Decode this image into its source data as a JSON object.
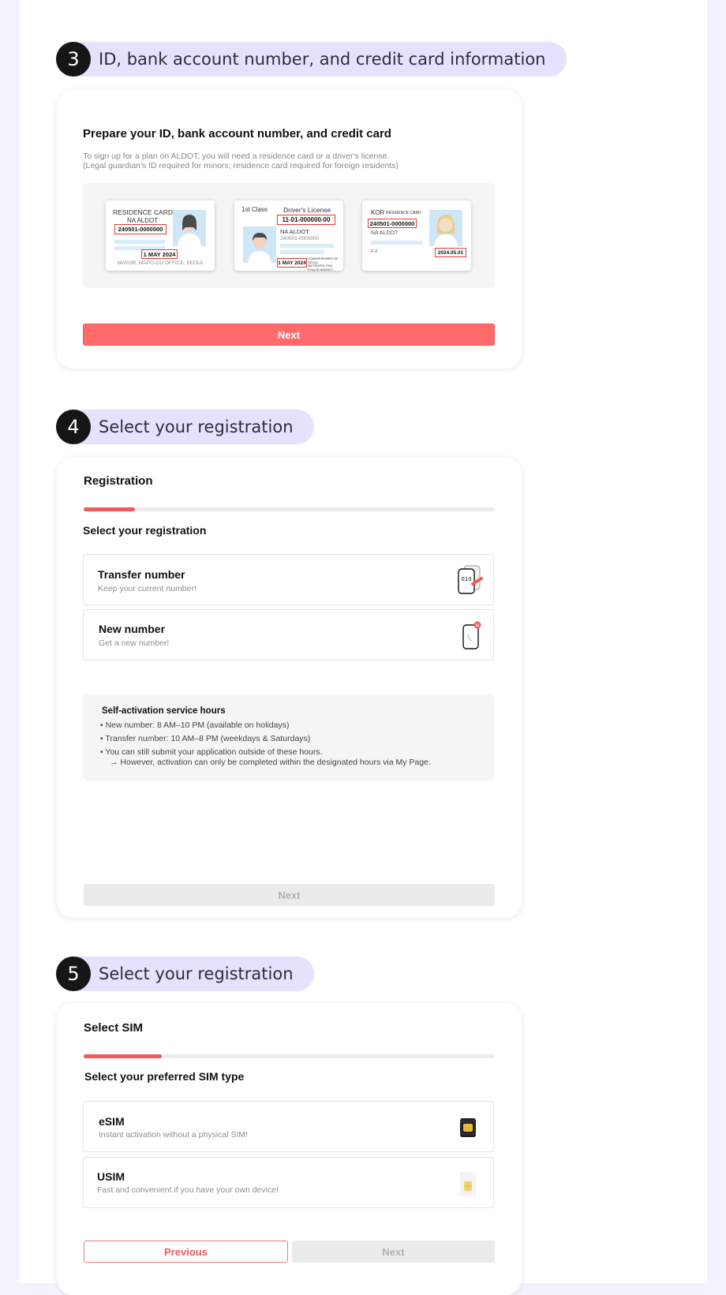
{
  "steps": [
    {
      "number": "3",
      "title": "ID, bank account number, and credit card information"
    },
    {
      "number": "4",
      "title": "Select your registration"
    },
    {
      "number": "5",
      "title": "Select your registration"
    }
  ],
  "id_section": {
    "heading": "Prepare your ID, bank account number, and credit card",
    "desc_line1": "To sign up for a plan on ALDOT, you will need a residence card or a driver's license.",
    "desc_line2": "(Legal guardian's ID required for minors; residence card required for foreign residents)",
    "card1": {
      "title": "RESIDENCE CARD",
      "name": "NA ALDOT",
      "id": "240501-0000000",
      "date": "1 MAY 2024",
      "issuer": "MAYOR, MAPO-GU OFFICE, SEOUL"
    },
    "card2": {
      "class": "1st Class",
      "title": "Driver's License",
      "number": "11-01-000000-00",
      "name": "NA ALDOT",
      "id": "240501-0000000",
      "date": "1 MAY 2024",
      "issuer": "COMMISSIONER OF SEOUL METROPOLITAN POLICE AGENCY"
    },
    "card3": {
      "country": "KOR",
      "title": "RESIDENCE CARD",
      "id": "240501-0000000",
      "name": "NA ALDOT",
      "visa": "F-2",
      "date": "2024.05.01"
    },
    "next_label": "Next"
  },
  "registration": {
    "heading": "Registration",
    "progress": 0.125,
    "question": "Select your registration",
    "options": [
      {
        "title": "Transfer number",
        "subtitle": "Keep your current number!",
        "icon": "phone-transfer-icon",
        "icon_text": "010"
      },
      {
        "title": "New number",
        "subtitle": "Get a new number!",
        "icon": "phone-new-icon",
        "icon_text": "N"
      }
    ],
    "notice": {
      "title": "Self-activation service hours",
      "line1": "• New number: 8 AM–10 PM (available on holidays)",
      "line2": "• Transfer number:  10 AM–8 PM (weekdays & Saturdays)",
      "line3": "• You can still submit your application outside of these hours.",
      "line4": "→ However, activation can only be completed within the designated hours via My Page."
    },
    "next_label": "Next"
  },
  "sim": {
    "heading": "Select SIM",
    "progress": 0.19,
    "question": "Select your preferred SIM type",
    "options": [
      {
        "title": "eSIM",
        "subtitle": "Instant activation without a physical SIM!",
        "icon": "esim-chip-icon"
      },
      {
        "title": "USIM",
        "subtitle": "Fast and convenient if you have your own device!",
        "icon": "usim-card-icon"
      }
    ],
    "previous_label": "Previous",
    "next_label": "Next"
  },
  "colors": {
    "accent": "#ff6b6b",
    "step_pill": "#e6e2fd",
    "background": "#f4f2fd"
  }
}
